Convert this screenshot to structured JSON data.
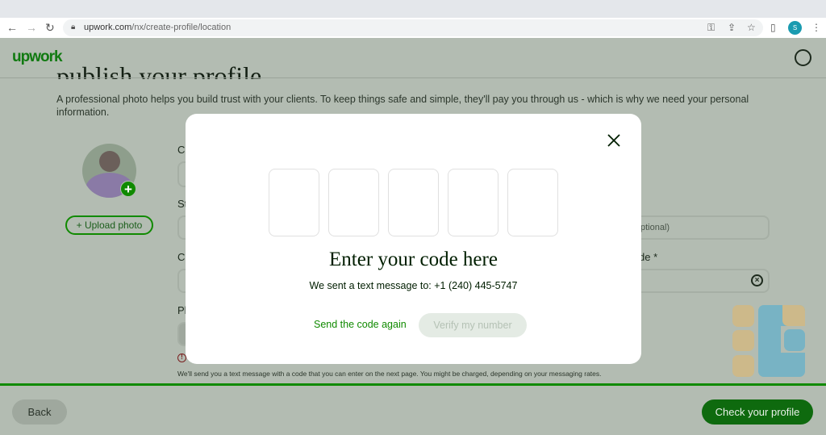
{
  "browser": {
    "url_host": "upwork.com",
    "url_path": "/nx/create-profile/location",
    "profile_initial": "S"
  },
  "header": {
    "logo": "upwork"
  },
  "page": {
    "heading": "publish your profile.",
    "intro": "A professional photo helps you build trust with your clients. To keep things safe and simple, they'll pay you through us - which is why we need your personal information.",
    "upload_label": "Upload photo",
    "labels": [
      "C",
      "St",
      "C",
      "Ph"
    ],
    "optional_placeholder_fragment": "ptional)",
    "code_label_fragment": "de *",
    "hint": "We'll send you a text message with a code that you can enter on the next page. You might be charged, depending on your messaging rates."
  },
  "footer": {
    "back": "Back",
    "next": "Check your profile"
  },
  "modal": {
    "title": "Enter your code here",
    "subtitle": "We sent a text message to: +1 (240) 445-5747",
    "resend": "Send the code again",
    "verify": "Verify my number",
    "code_digits": 5
  },
  "colors": {
    "brand": "#108a00",
    "overlay": "#b3bcb2"
  }
}
